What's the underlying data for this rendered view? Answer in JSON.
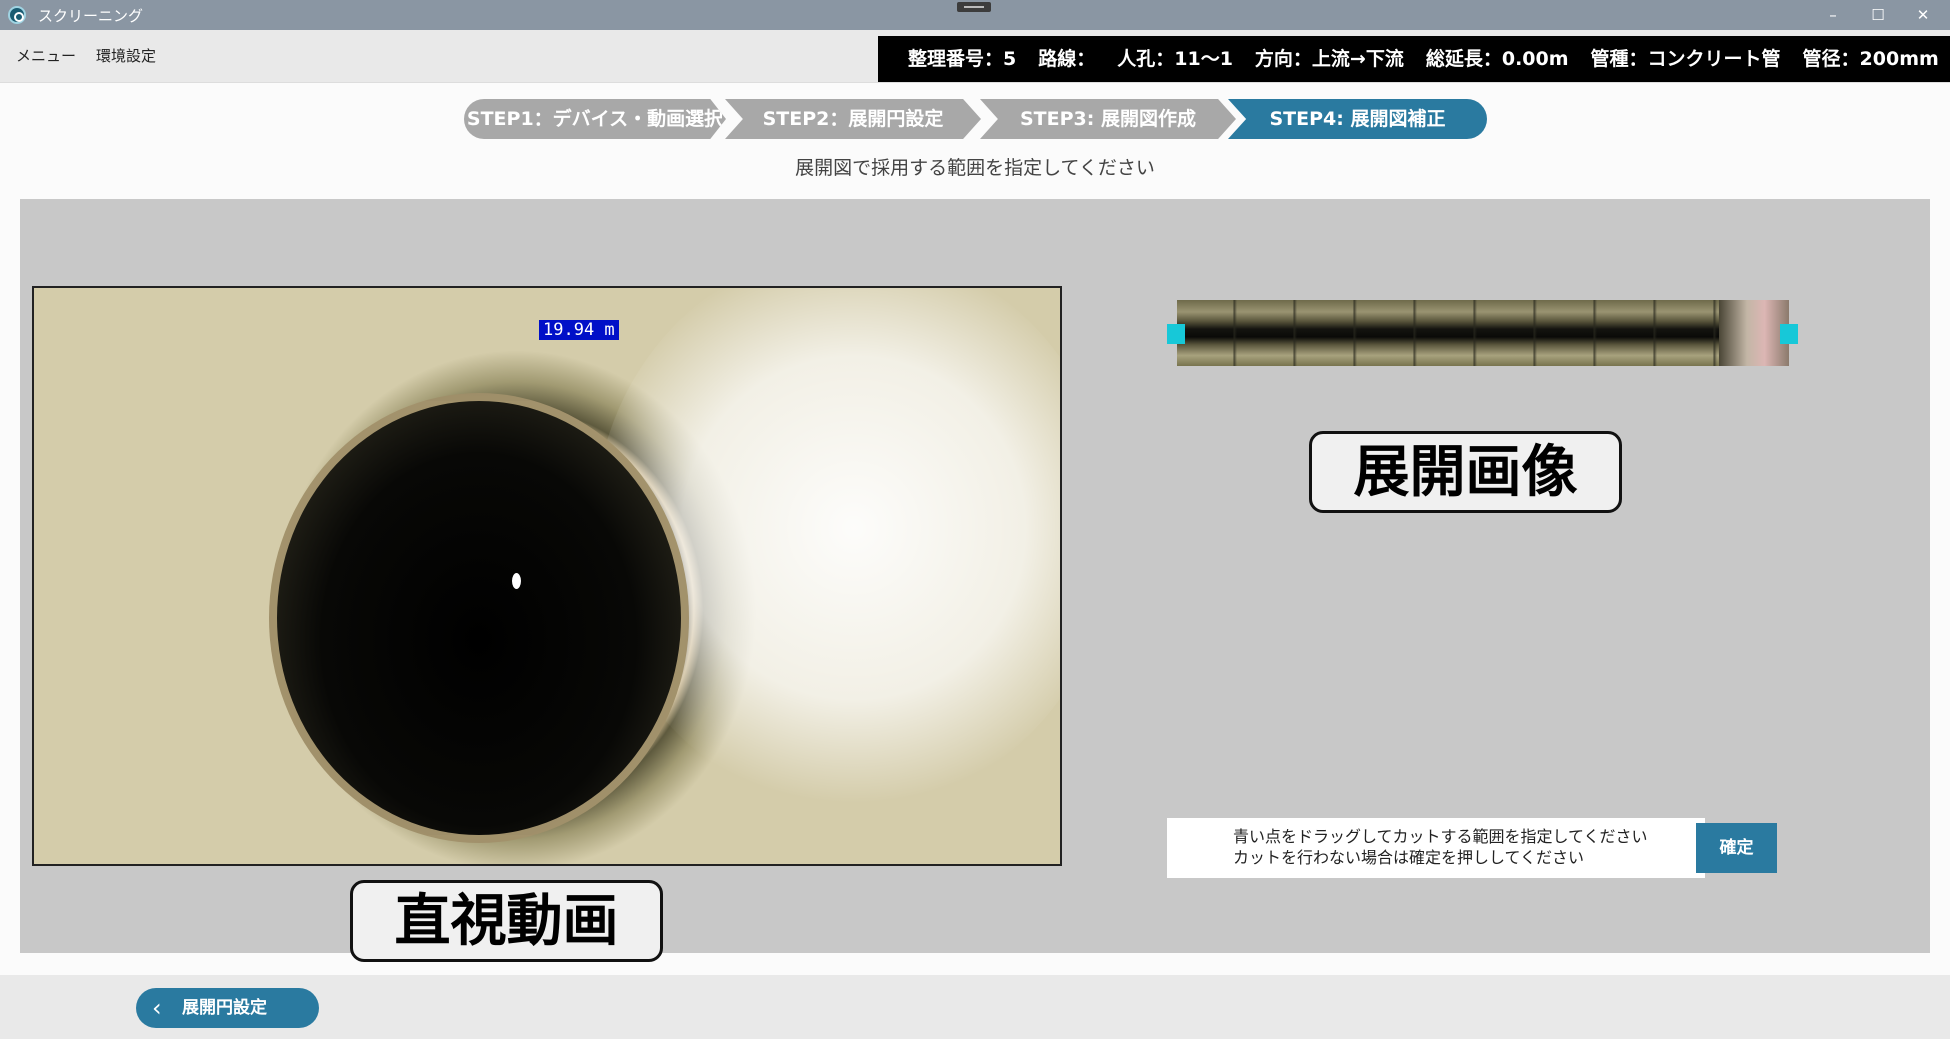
{
  "window": {
    "title": "スクリーニング",
    "minimize_glyph": "–",
    "maximize_glyph": "☐",
    "close_glyph": "✕"
  },
  "menu": {
    "items": [
      {
        "label": "メニュー"
      },
      {
        "label": "環境設定"
      }
    ]
  },
  "info_banner": {
    "management_no": "整理番号：5",
    "route": "路線：",
    "manhole": "人孔：11〜1",
    "direction": "方向：上流→下流",
    "total_length": "総延長：0.00m",
    "pipe_type": "管種：コンクリート管",
    "pipe_diameter": "管径：200mm"
  },
  "steps": [
    {
      "label": "STEP1：デバイス・動画選択",
      "active": false
    },
    {
      "label": "STEP2：展開円設定",
      "active": false
    },
    {
      "label": "STEP3: 展開図作成",
      "active": false
    },
    {
      "label": "STEP4: 展開図補正",
      "active": true
    }
  ],
  "instruction": "展開図で採用する範囲を指定してください",
  "video": {
    "distance_overlay": "19.94 m",
    "caption": "直視動画"
  },
  "panorama": {
    "caption": "展開画像"
  },
  "hint": {
    "line1": "青い点をドラッグしてカットする範囲を指定してください",
    "line2": "カットを行わない場合は確定を押ししてください"
  },
  "confirm_label": "確定",
  "back_button_label": "展開円設定",
  "colors": {
    "accent": "#2a7aa0",
    "handle": "#17c8d8",
    "step_inactive": "#a8a8a8",
    "banner_bg": "#000000"
  },
  "icons": {
    "app": "app-logo-icon",
    "back": "chevron-left-icon"
  }
}
